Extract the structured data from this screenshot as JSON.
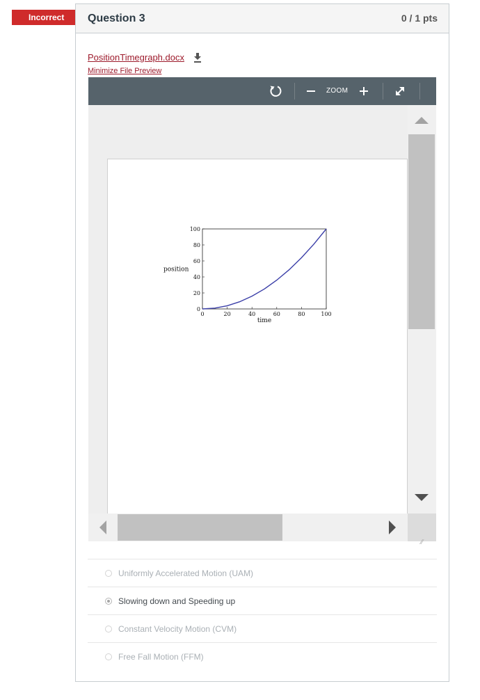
{
  "status_badge": "Incorrect",
  "question": {
    "title": "Question 3",
    "points": "0 / 1 pts"
  },
  "file": {
    "name": "PositionTimegraph.docx",
    "minimize_label": "Minimize File Preview"
  },
  "viewer": {
    "zoom_label": "ZOOM"
  },
  "colors": {
    "badge": "#cf2b2b",
    "toolbar": "#56636b",
    "link": "#9d1a2b",
    "series": "#3b3fa8"
  },
  "chart_data": {
    "type": "line",
    "xlabel": "time",
    "ylabel": "position",
    "xlim": [
      0,
      100
    ],
    "ylim": [
      0,
      100
    ],
    "xticks": [
      "0",
      "20",
      "40",
      "60",
      "80",
      "100"
    ],
    "yticks": [
      "0",
      "20",
      "40",
      "60",
      "80",
      "100"
    ],
    "grid": false,
    "series": [
      {
        "x": [
          0,
          10,
          20,
          30,
          40,
          50,
          60,
          70,
          80,
          90,
          100
        ],
        "y": [
          0,
          1,
          4,
          9,
          16,
          25,
          36,
          49,
          64,
          81,
          100
        ]
      }
    ]
  },
  "answers": [
    {
      "label": "Uniformly Accelerated Motion (UAM)",
      "selected": false
    },
    {
      "label": "Slowing down and Speeding up",
      "selected": true
    },
    {
      "label": "Constant Velocity Motion (CVM)",
      "selected": false
    },
    {
      "label": "Free Fall Motion (FFM)",
      "selected": false
    }
  ]
}
